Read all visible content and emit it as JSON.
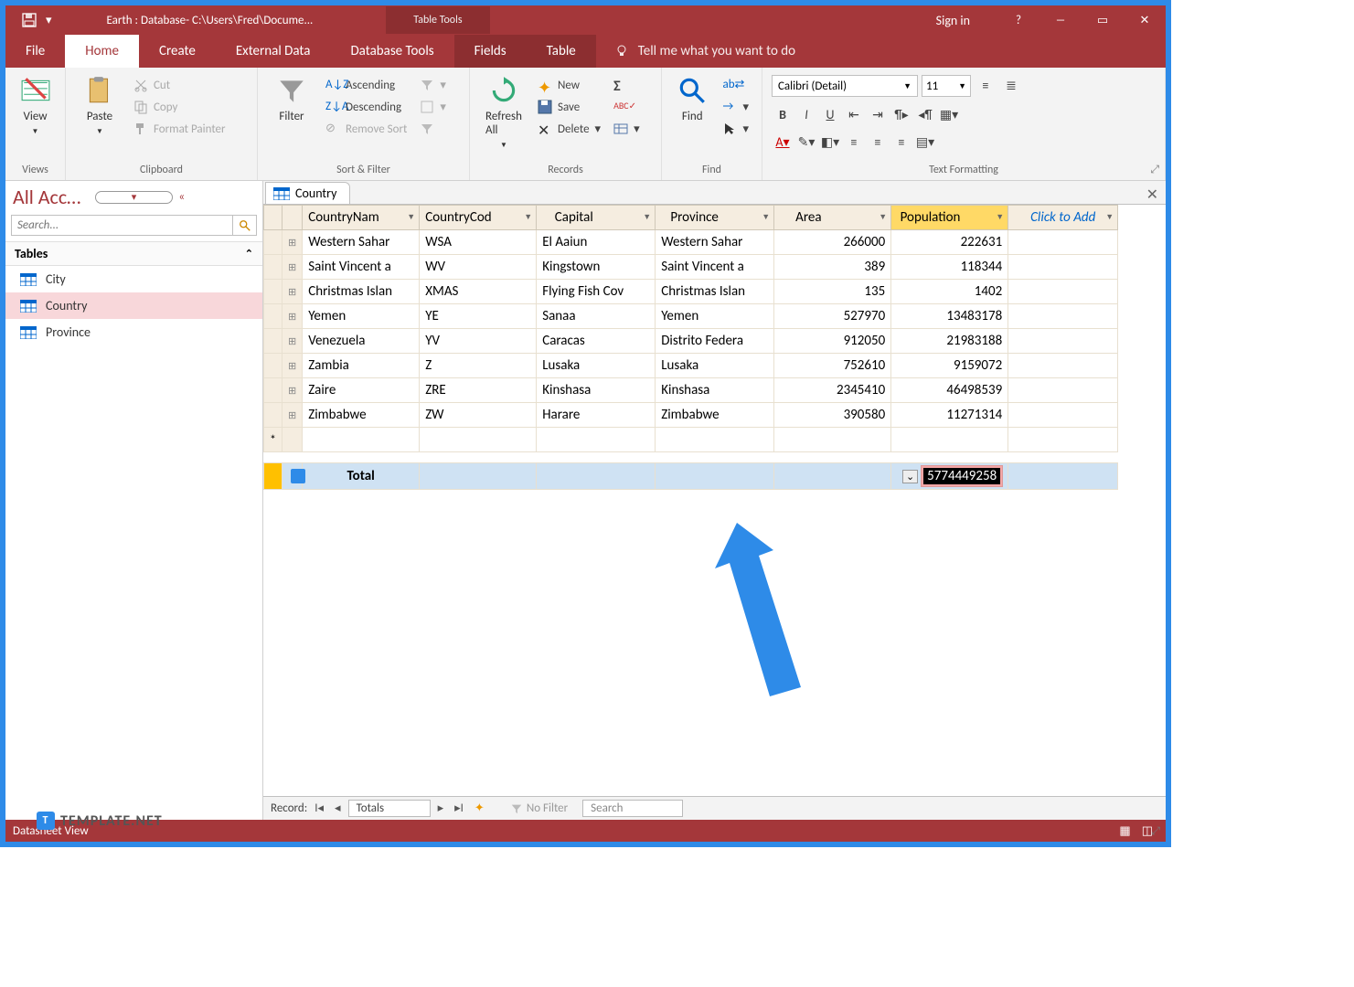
{
  "titlebar": {
    "title": "Earth : Database- C:\\Users\\Fred\\Docume...",
    "tabletools": "Table Tools",
    "signin": "Sign in"
  },
  "tabs": {
    "file": "File",
    "home": "Home",
    "create": "Create",
    "external": "External Data",
    "dbtools": "Database Tools",
    "fields": "Fields",
    "table": "Table",
    "tellme": "Tell me what you want to do"
  },
  "ribbon": {
    "views": {
      "view": "View",
      "label": "Views"
    },
    "clipboard": {
      "paste": "Paste",
      "cut": "Cut",
      "copy": "Copy",
      "fmt": "Format Painter",
      "label": "Clipboard"
    },
    "sort": {
      "filter": "Filter",
      "asc": "Ascending",
      "desc": "Descending",
      "remove": "Remove Sort",
      "label": "Sort & Filter"
    },
    "records": {
      "refresh": "Refresh\nAll",
      "new": "New",
      "save": "Save",
      "delete": "Delete",
      "label": "Records"
    },
    "find": {
      "find": "Find",
      "label": "Find"
    },
    "textfmt": {
      "font": "Calibri (Detail)",
      "size": "11",
      "label": "Text Formatting"
    }
  },
  "nav": {
    "title": "All Access Obje...",
    "search_ph": "Search...",
    "group": "Tables",
    "items": [
      "City",
      "Country",
      "Province"
    ]
  },
  "doctab": "Country",
  "columns": [
    "CountryNam",
    "CountryCod",
    "Capital",
    "Province",
    "Area",
    "Population",
    "Click to Add"
  ],
  "rows": [
    {
      "name": "Western Sahar",
      "code": "WSA",
      "cap": "El Aaiun",
      "prov": "Western Sahar",
      "area": "266000",
      "pop": "222631"
    },
    {
      "name": "Saint Vincent a",
      "code": "WV",
      "cap": "Kingstown",
      "prov": "Saint Vincent a",
      "area": "389",
      "pop": "118344"
    },
    {
      "name": "Christmas Islan",
      "code": "XMAS",
      "cap": "Flying Fish Cov",
      "prov": "Christmas Islan",
      "area": "135",
      "pop": "1402"
    },
    {
      "name": "Yemen",
      "code": "YE",
      "cap": "Sanaa",
      "prov": "Yemen",
      "area": "527970",
      "pop": "13483178"
    },
    {
      "name": "Venezuela",
      "code": "YV",
      "cap": "Caracas",
      "prov": "Distrito Federa",
      "area": "912050",
      "pop": "21983188"
    },
    {
      "name": "Zambia",
      "code": "Z",
      "cap": "Lusaka",
      "prov": "Lusaka",
      "area": "752610",
      "pop": "9159072"
    },
    {
      "name": "Zaire",
      "code": "ZRE",
      "cap": "Kinshasa",
      "prov": "Kinshasa",
      "area": "2345410",
      "pop": "46498539"
    },
    {
      "name": "Zimbabwe",
      "code": "ZW",
      "cap": "Harare",
      "prov": "Zimbabwe",
      "area": "390580",
      "pop": "11271314"
    }
  ],
  "total": {
    "label": "Total",
    "value": "5774449258"
  },
  "recordnav": {
    "label": "Record:",
    "current": "Totals",
    "nofilter": "No Filter",
    "search": "Search"
  },
  "status": "Datasheet View",
  "watermark": "TEMPLATE.NET"
}
